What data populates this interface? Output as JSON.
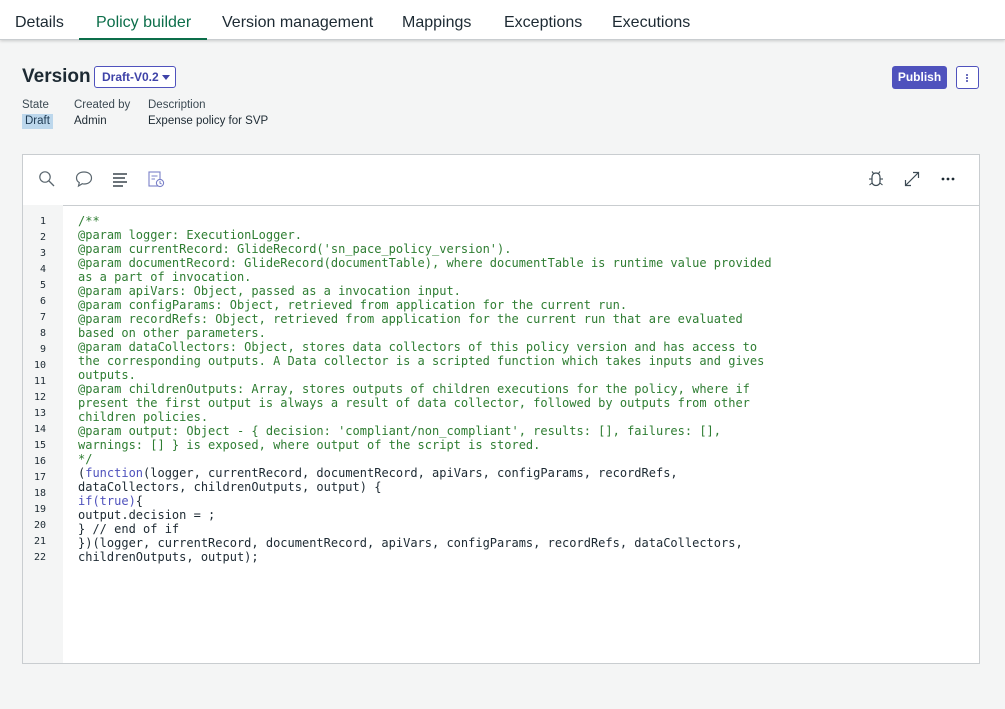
{
  "tabs": [
    {
      "label": "Details"
    },
    {
      "label": "Policy builder",
      "active": true
    },
    {
      "label": "Version management"
    },
    {
      "label": "Mappings"
    },
    {
      "label": "Exceptions"
    },
    {
      "label": "Executions"
    }
  ],
  "version": {
    "title": "Version",
    "selected": "Draft-V0.2"
  },
  "actions": {
    "publish_label": "Publish",
    "more_icon": "more-vertical-icon"
  },
  "meta": {
    "state_label": "State",
    "state_value": "Draft",
    "created_by_label": "Created by",
    "created_by_value": "Admin",
    "description_label": "Description",
    "description_value": "Expense policy for SVP"
  },
  "toolbar_icons": [
    "search-icon",
    "comment-icon",
    "format-icon",
    "history-icon",
    "debug-icon",
    "expand-icon",
    "more-horizontal-icon"
  ],
  "code": {
    "lines": [
      "1",
      "2",
      "3",
      "4",
      "5",
      "6",
      "7",
      "8",
      "9",
      "10",
      "11",
      "12",
      "13",
      "14",
      "15",
      "16",
      "17",
      "18",
      "19",
      "20",
      "21",
      "22"
    ],
    "text": [
      "/**",
      "@param logger: ExecutionLogger.",
      "@param currentRecord: GlideRecord('sn_pace_policy_version').",
      "@param documentRecord: GlideRecord(documentTable), where documentTable is runtime value provided",
      "as a part of invocation.",
      "@param apiVars: Object, passed as a invocation input.",
      "@param configParams: Object, retrieved from application for the current run.",
      "@param recordRefs: Object, retrieved from application for the current run that are evaluated",
      "based on other parameters.",
      "@param dataCollectors: Object, stores data collectors of this policy version and has access to",
      "the corresponding outputs. A Data collector is a scripted function which takes inputs and gives",
      "outputs.",
      "@param childrenOutputs: Array, stores outputs of children executions for the policy, where if",
      "present the first output is always a result of data collector, followed by outputs from other",
      "children policies.",
      "@param output: Object - { decision: 'compliant/non_compliant', results: [], failures: [],",
      "warnings: [] } is exposed, where output of the script is stored.",
      "*/",
      "(",
      "function",
      "(logger, currentRecord, documentRecord, apiVars, configParams, recordRefs,",
      "dataCollectors, childrenOutputs, output) {",
      "if(true)",
      "{",
      "output.decision = ;",
      "} // end of if",
      "})(logger, currentRecord, documentRecord, apiVars, configParams, recordRefs, dataCollectors,",
      "childrenOutputs, output);"
    ]
  }
}
